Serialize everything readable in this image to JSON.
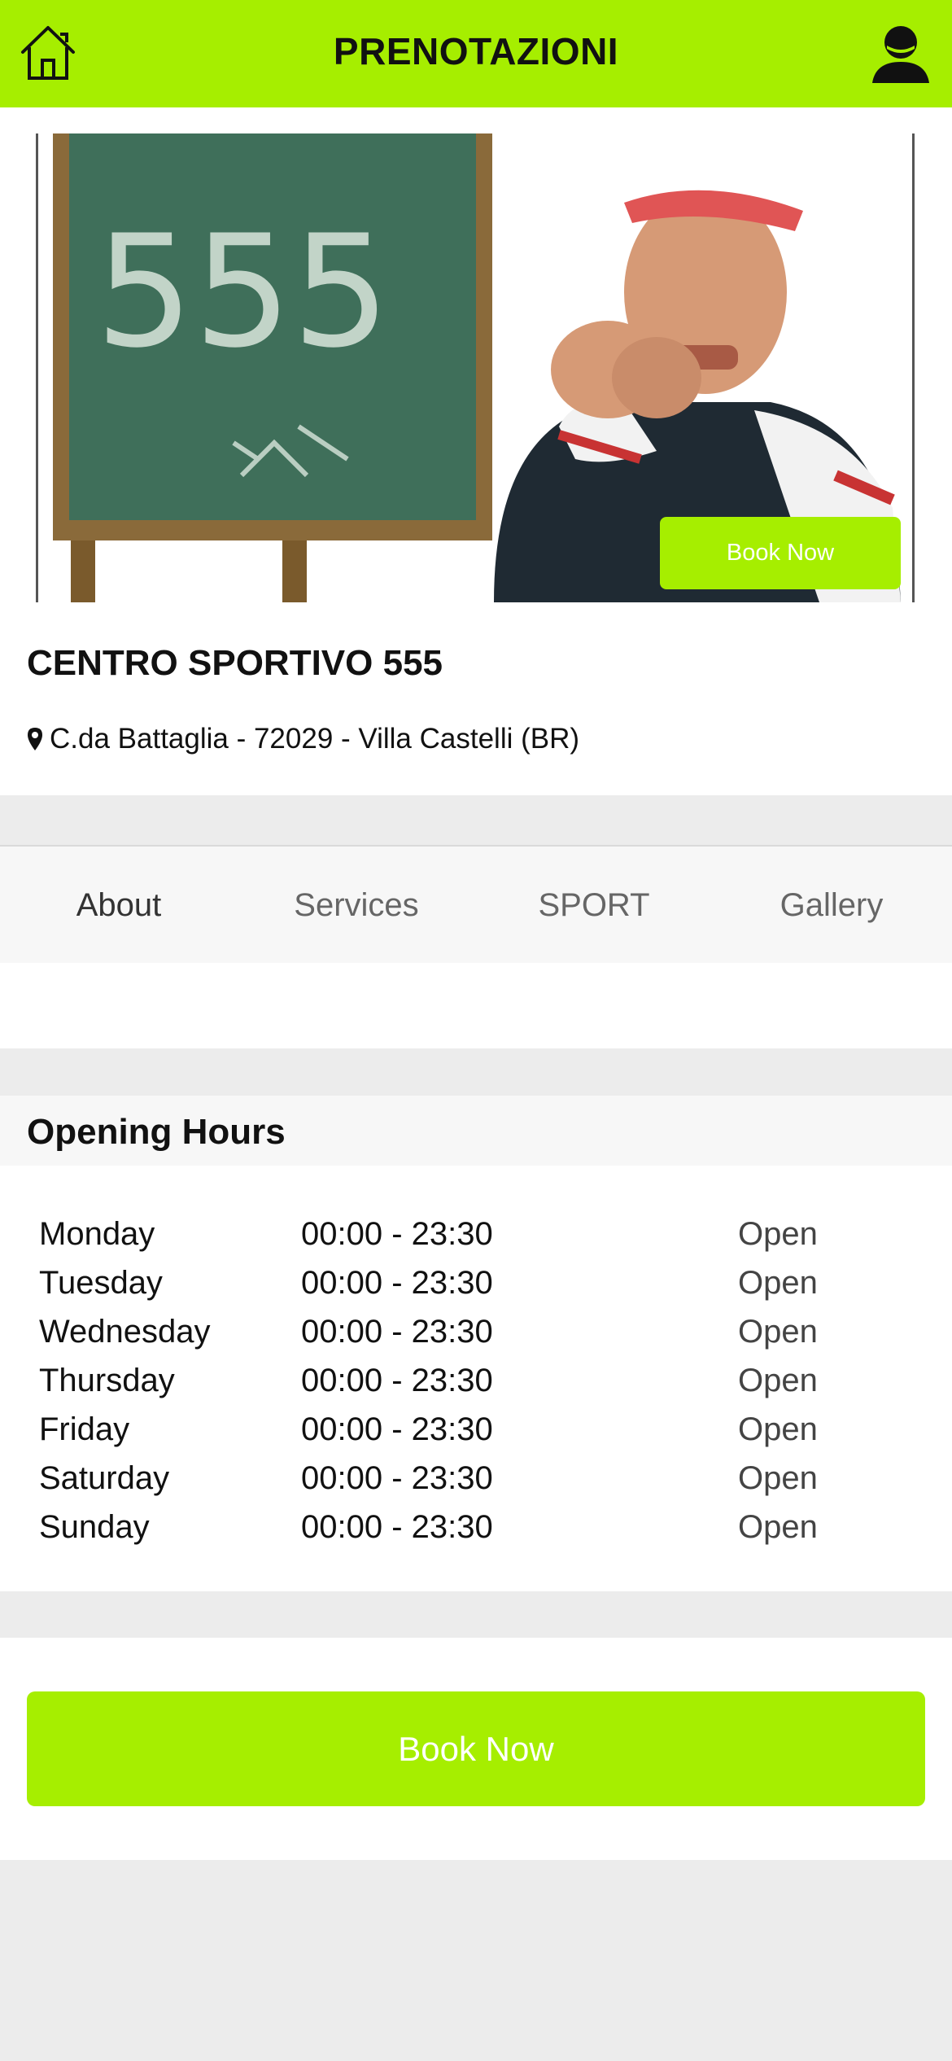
{
  "header": {
    "title": "PRENOTAZIONI",
    "home_icon": "home-icon",
    "user_icon": "user-icon"
  },
  "hero": {
    "chalkboard_text": "555",
    "book_button": "Book Now"
  },
  "venue": {
    "name": "CENTRO SPORTIVO 555",
    "address": "C.da Battaglia - 72029 - Villa Castelli (BR)"
  },
  "tabs": [
    {
      "label": "About"
    },
    {
      "label": "Services"
    },
    {
      "label": "SPORT"
    },
    {
      "label": "Gallery"
    }
  ],
  "opening_hours": {
    "title": "Opening Hours",
    "rows": [
      {
        "day": "Monday",
        "time": "00:00 - 23:30",
        "status": "Open"
      },
      {
        "day": "Tuesday",
        "time": "00:00 - 23:30",
        "status": "Open"
      },
      {
        "day": "Wednesday",
        "time": "00:00 - 23:30",
        "status": "Open"
      },
      {
        "day": "Thursday",
        "time": "00:00 - 23:30",
        "status": "Open"
      },
      {
        "day": "Friday",
        "time": "00:00 - 23:30",
        "status": "Open"
      },
      {
        "day": "Saturday",
        "time": "00:00 - 23:30",
        "status": "Open"
      },
      {
        "day": "Sunday",
        "time": "00:00 - 23:30",
        "status": "Open"
      }
    ]
  },
  "footer": {
    "book_button": "Book Now"
  },
  "colors": {
    "accent": "#a6ee00",
    "background": "#ececec"
  }
}
